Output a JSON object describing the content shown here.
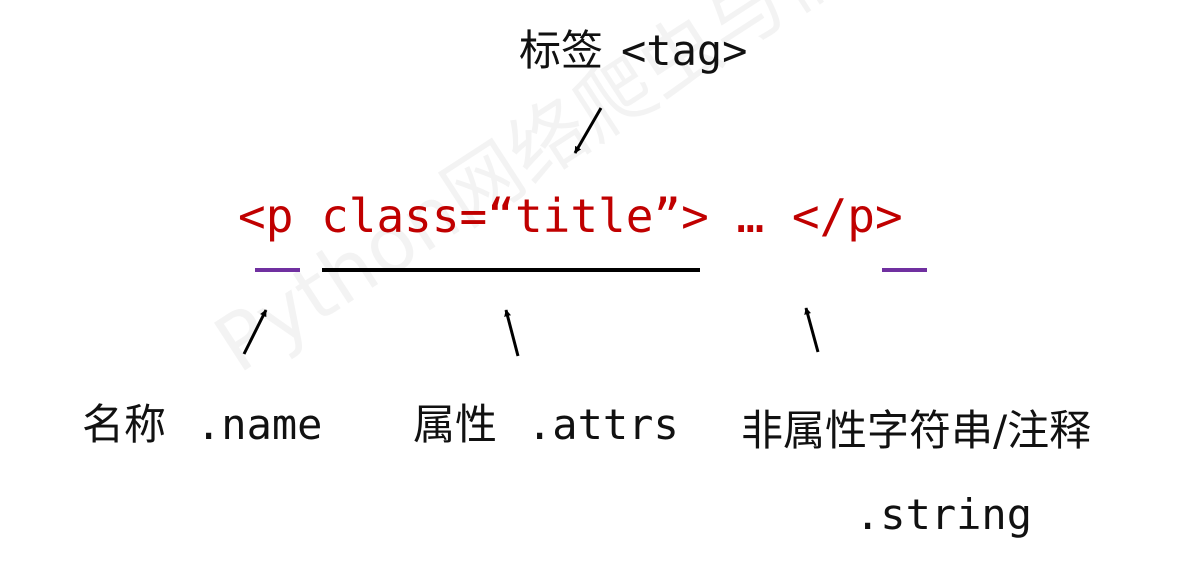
{
  "tag": {
    "cn": "标签",
    "code": "<tag>"
  },
  "code_line": "<p class=“title”> … </p>",
  "name": {
    "cn": "名称",
    "prop": ".name"
  },
  "attrs": {
    "cn": "属性",
    "prop": ".attrs"
  },
  "string": {
    "cn": "非属性字符串/注释",
    "prop": ".string"
  },
  "watermark": "Python网络爬虫与信息提取",
  "colors": {
    "code": "#c00000",
    "name_underline": "#7030a0",
    "attrs_underline": "#000000",
    "arrow": "#000000"
  }
}
